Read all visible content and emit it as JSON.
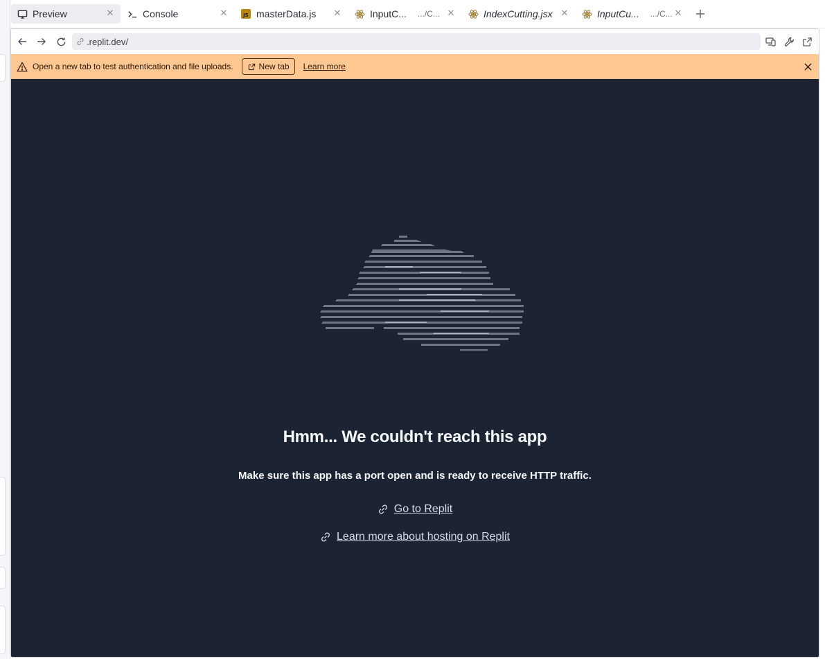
{
  "tabs": [
    {
      "label": "Preview",
      "icon": "monitor-icon",
      "active": true
    },
    {
      "label": "Console",
      "icon": "terminal-icon"
    },
    {
      "label": "masterData.js",
      "icon": "js-file-icon"
    },
    {
      "label": "InputC...",
      "path": ".../C...",
      "icon": "react-icon"
    },
    {
      "label": "IndexCutting.jsx",
      "icon": "react-icon",
      "italic": true
    },
    {
      "label": "InputCu...",
      "path": ".../C...",
      "icon": "react-icon",
      "italic": true
    }
  ],
  "address_bar": {
    "url": ".replit.dev/"
  },
  "banner": {
    "message": "Open a new tab to test authentication and file uploads.",
    "new_tab_label": "New tab",
    "learn_more_label": "Learn more",
    "background": "#ffc792"
  },
  "page": {
    "title": "Hmm... We couldn't reach this app",
    "subtitle": "Make sure this app has a port open and is ready to receive HTTP traffic.",
    "link_replit": "Go to Replit",
    "link_hosting": "Learn more about hosting on Replit",
    "background": "#1c2333"
  }
}
